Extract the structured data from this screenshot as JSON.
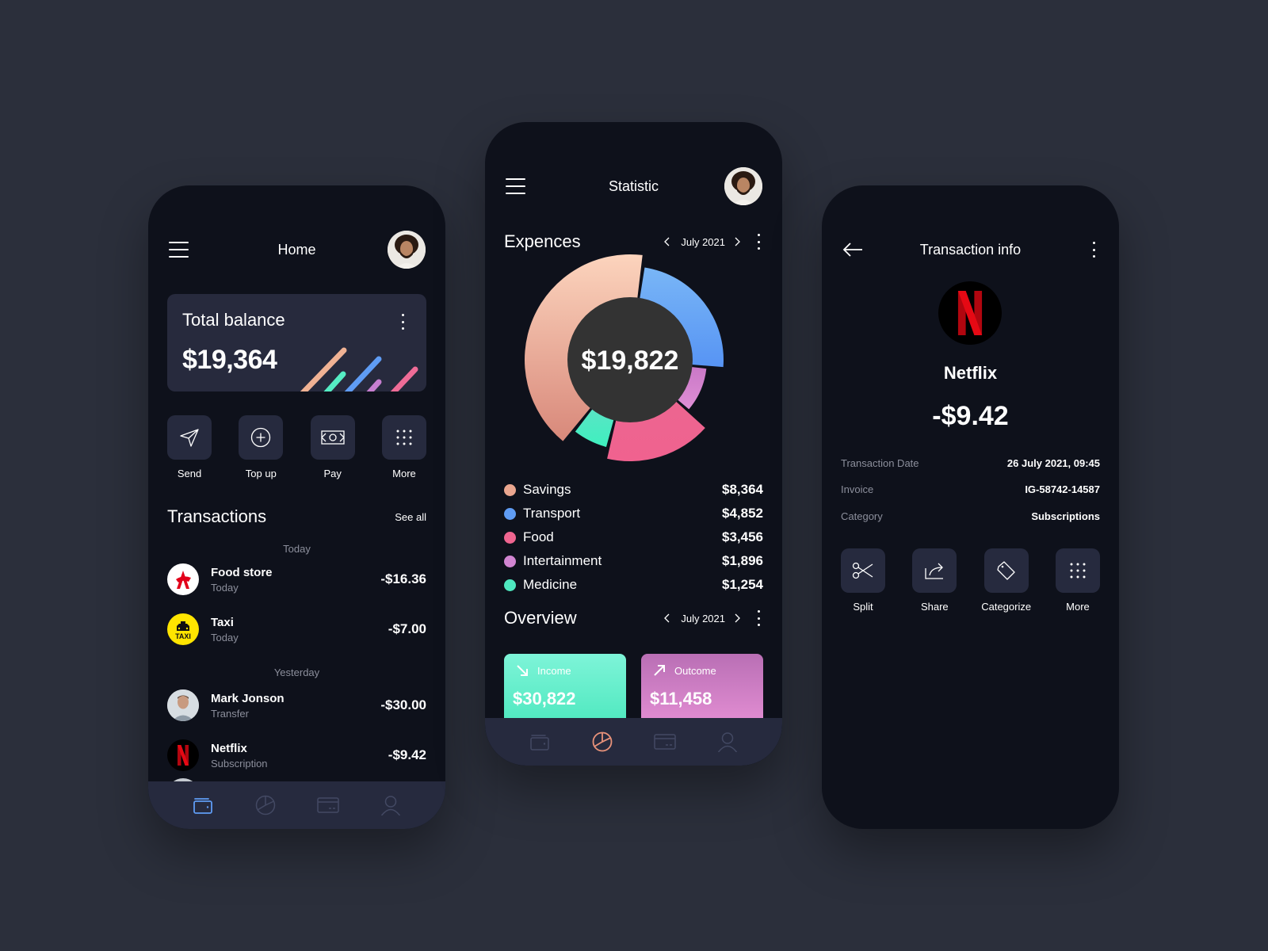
{
  "home": {
    "title": "Home",
    "balance": {
      "label": "Total balance",
      "value": "$19,364",
      "stripe_colors": [
        "#f4b79c",
        "#55edc4",
        "#5f9cf4",
        "#c77fd0",
        "#ef6c97"
      ]
    },
    "actions": [
      {
        "label": "Send",
        "icon": "send-icon"
      },
      {
        "label": "Top up",
        "icon": "plus-circle-icon"
      },
      {
        "label": "Pay",
        "icon": "money-icon"
      },
      {
        "label": "More",
        "icon": "grid-dots-icon"
      }
    ],
    "transactions_title": "Transactions",
    "see_all": "See all",
    "groups": [
      {
        "label": "Today",
        "items": [
          {
            "name": "Food store",
            "sub": "Today",
            "amount": "-$16.36",
            "logo": "food-store-logo"
          },
          {
            "name": "Taxi",
            "sub": "Today",
            "amount": "-$7.00",
            "logo": "taxi-logo",
            "logo_text": "TAXI"
          }
        ]
      },
      {
        "label": "Yesterday",
        "items": [
          {
            "name": "Mark Jonson",
            "sub": "Transfer",
            "amount": "-$30.00",
            "logo": "person-avatar"
          },
          {
            "name": "Netflix",
            "sub": "Subscription",
            "amount": "-$9.42",
            "logo": "netflix-logo"
          }
        ]
      }
    ],
    "tabbar": {
      "active": "wallet",
      "items": [
        "wallet",
        "statistics",
        "cards",
        "profile"
      ]
    }
  },
  "statistic": {
    "title": "Statistic",
    "expenses_title": "Expences",
    "month": "July 2021",
    "total": "$19,822",
    "overview_title": "Overview",
    "overview_month": "July 2021",
    "income": {
      "label": "Income",
      "value": "$30,822"
    },
    "outcome": {
      "label": "Outcome",
      "value": "$11,458"
    },
    "tabbar": {
      "active": "statistics",
      "items": [
        "wallet",
        "statistics",
        "cards",
        "profile"
      ]
    }
  },
  "chart_data": {
    "type": "pie",
    "title": "Expences",
    "center_label": "$19,822",
    "categories": [
      "Savings",
      "Transport",
      "Food",
      "Intertainment",
      "Medicine"
    ],
    "values": [
      8364,
      4852,
      3456,
      1896,
      1254
    ],
    "labels": [
      "$8,364",
      "$4,852",
      "$3,456",
      "$1,896",
      "$1,254"
    ],
    "colors": [
      "#eaa68f",
      "#5f9cf4",
      "#ef6590",
      "#d185d1",
      "#4ee8bf"
    ],
    "legend": "bottom"
  },
  "transaction": {
    "title": "Transaction info",
    "merchant": "Netflix",
    "amount": "-$9.42",
    "details": [
      {
        "label": "Transaction Date",
        "value": "26 July 2021, 09:45"
      },
      {
        "label": "Invoice",
        "value": "IG-58742-14587"
      },
      {
        "label": "Category",
        "value": "Subscriptions"
      }
    ],
    "actions": [
      {
        "label": "Split",
        "icon": "scissors-icon"
      },
      {
        "label": "Share",
        "icon": "share-icon"
      },
      {
        "label": "Categorize",
        "icon": "tag-icon"
      },
      {
        "label": "More",
        "icon": "grid-dots-icon"
      }
    ]
  }
}
